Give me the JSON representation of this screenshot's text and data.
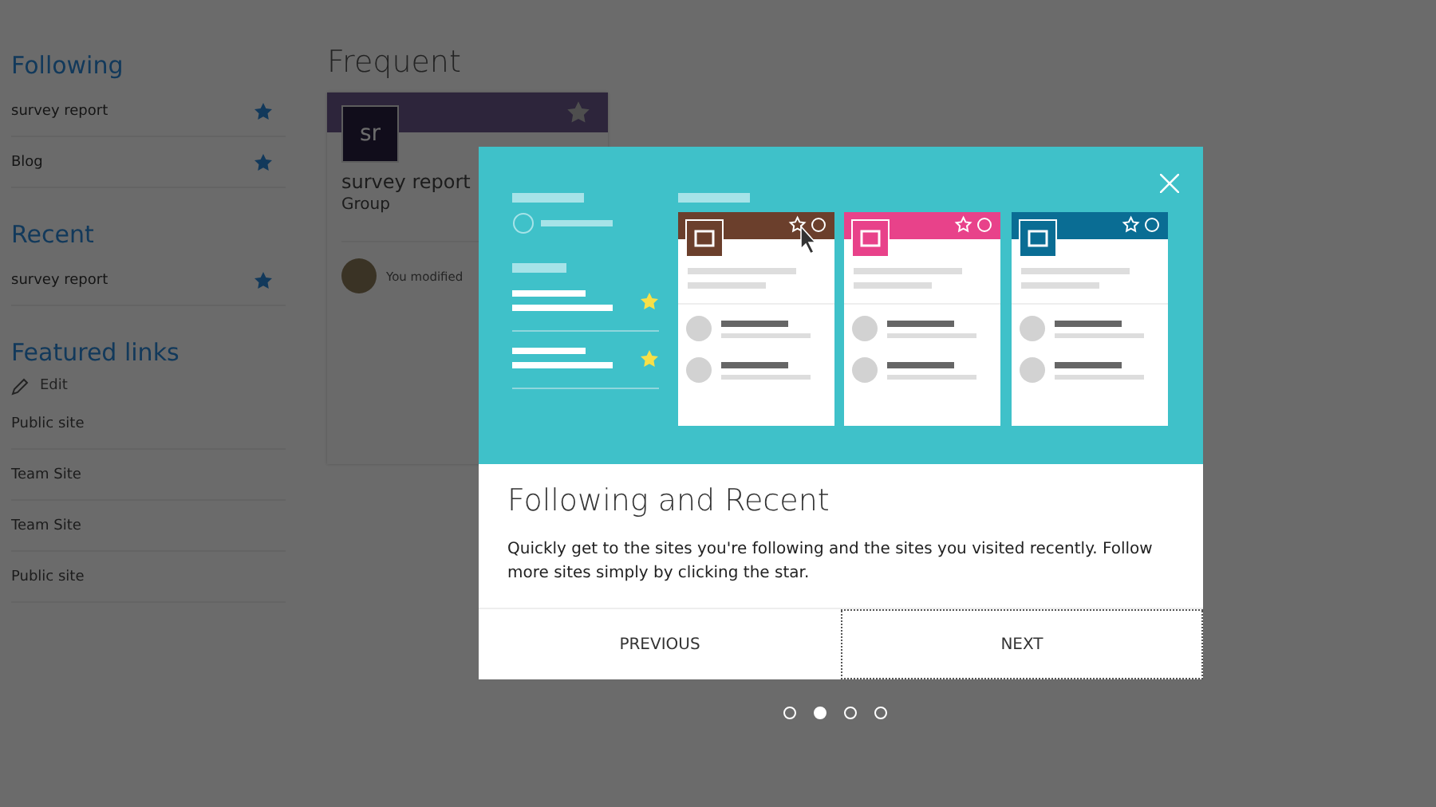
{
  "sidebar": {
    "sections": [
      {
        "heading": "Following",
        "items": [
          {
            "label": "survey report",
            "starred": true
          },
          {
            "label": "Blog",
            "starred": true
          }
        ]
      },
      {
        "heading": "Recent",
        "items": [
          {
            "label": "survey report",
            "starred": true
          }
        ]
      }
    ],
    "featured": {
      "heading": "Featured links",
      "edit": "Edit",
      "links": [
        "Public site",
        "Team Site",
        "Team Site",
        "Public site"
      ]
    }
  },
  "main": {
    "heading": "Frequent",
    "card": {
      "initials": "sr",
      "title": "survey report",
      "subtitle": "Group",
      "activity": "You modified"
    }
  },
  "dialog": {
    "title": "Following and Recent",
    "description": "Quickly get to the sites you're following and the sites you visited recently. Follow more sites simply by clicking the star.",
    "buttons": [
      {
        "label": "PREVIOUS",
        "focused": false
      },
      {
        "label": "NEXT",
        "focused": true
      }
    ]
  },
  "pager": [
    {
      "selected": false
    },
    {
      "selected": true
    },
    {
      "selected": false
    },
    {
      "selected": false
    }
  ]
}
